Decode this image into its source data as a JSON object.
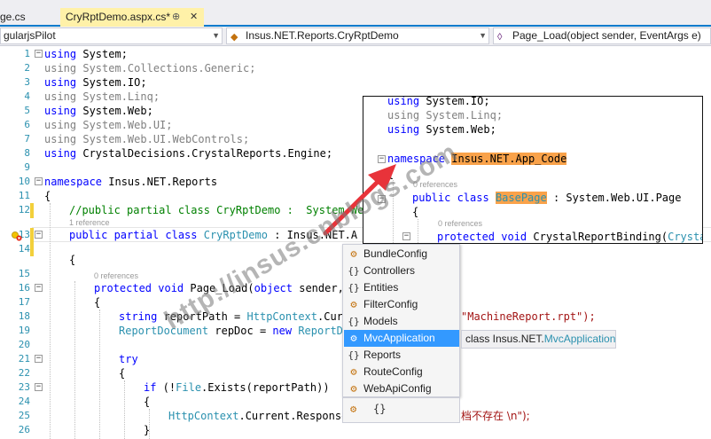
{
  "tabs": [
    {
      "label": "ge.cs"
    },
    {
      "label": "CryRptDemo.aspx.cs*",
      "pin": "⊕",
      "close": "✕"
    }
  ],
  "nav": {
    "project": "gularjsPilot",
    "class": "Insus.NET.Reports.CryRptDemo",
    "member": "Page_Load(object sender, EventArgs e)"
  },
  "lines": [
    {
      "n": "1",
      "code": "using System;"
    },
    {
      "n": "2",
      "code": "using System.Collections.Generic;"
    },
    {
      "n": "3",
      "code": "using System.IO;"
    },
    {
      "n": "4",
      "code": "using System.Linq;"
    },
    {
      "n": "5",
      "code": "using System.Web;"
    },
    {
      "n": "6",
      "code": "using System.Web.UI;"
    },
    {
      "n": "7",
      "code": "using System.Web.UI.WebControls;"
    },
    {
      "n": "8",
      "code": "using CrystalDecisions.CrystalReports.Engine;"
    },
    {
      "n": "9",
      "code": ""
    },
    {
      "n": "10",
      "code": "namespace Insus.NET.Reports"
    },
    {
      "n": "11",
      "code": "{"
    },
    {
      "n": "12",
      "code": "//public partial class CryRptDemo :  System.Web.UI.Page"
    },
    {
      "n": "13",
      "code": "public partial class CryRptDemo : Insus.NET.A"
    },
    {
      "n": "14",
      "code": ""
    },
    {
      "n": "15",
      "code": "{"
    },
    {
      "n": "16",
      "code": "protected void Page_Load(object sender,"
    },
    {
      "n": "17",
      "code": "{"
    },
    {
      "n": "18",
      "code": "string reportPath = HttpContext.Curr"
    },
    {
      "n": "19",
      "code": "ReportDocument repDoc = new ReportDo"
    },
    {
      "n": "20",
      "code": ""
    },
    {
      "n": "21",
      "code": "try"
    },
    {
      "n": "22",
      "code": "{"
    },
    {
      "n": "23",
      "code": "if (!File.Exists(reportPath))"
    },
    {
      "n": "24",
      "code": "{"
    },
    {
      "n": "25",
      "code": "HttpContext.Current.Response"
    },
    {
      "n": "26",
      "code": "}"
    }
  ],
  "codelens": {
    "one_ref": "1 reference",
    "zero_ref": "0 references"
  },
  "line18_tail": "\"MachineReport.rpt\");",
  "line25_tail": "档不存在 \\n\");",
  "inset": {
    "lines": [
      "using System.IO;",
      "using System.Linq;",
      "using System.Web;"
    ],
    "namespace_kw": "namespace",
    "namespace_name": "Insus.NET.App_Code",
    "brace": "{",
    "ref1": "0 references",
    "class_decl_pre": "public class",
    "class_name": "BasePage",
    "class_decl_post": ": System.Web.UI.Page",
    "brace2": "{",
    "ref2": "0 references",
    "method": "protected void CrystalReportBinding(Crysta"
  },
  "intellisense": {
    "items": [
      {
        "label": "BundleConfig",
        "icon": "class-icon"
      },
      {
        "label": "Controllers",
        "icon": "namespace-icon"
      },
      {
        "label": "Entities",
        "icon": "namespace-icon"
      },
      {
        "label": "FilterConfig",
        "icon": "class-icon"
      },
      {
        "label": "Models",
        "icon": "namespace-icon"
      },
      {
        "label": "MvcApplication",
        "icon": "class-icon",
        "selected": true
      },
      {
        "label": "Reports",
        "icon": "namespace-icon"
      },
      {
        "label": "RouteConfig",
        "icon": "class-icon"
      },
      {
        "label": "WebApiConfig",
        "icon": "class-icon"
      }
    ],
    "tooltip_prefix": "class Insus.NET.",
    "tooltip_name": "MvcApplication"
  },
  "watermark": "http://insus.cnblogs.com",
  "colors": {
    "accent": "#007acc",
    "keyword": "#0000ff",
    "type": "#2b91af",
    "comment": "#008000",
    "string": "#a31515",
    "highlight": "#f9a24a",
    "selection": "#3399ff",
    "arrow": "#e8333a"
  }
}
